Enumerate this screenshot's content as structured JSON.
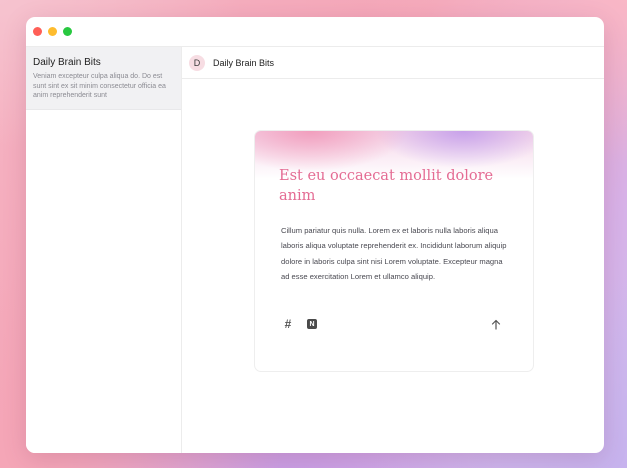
{
  "sidebar": {
    "items": [
      {
        "title": "Daily Brain Bits",
        "snippet": "Veniam excepteur culpa aliqua do. Do est sunt sint ex sit minim consectetur officia ea anim reprehenderit sunt"
      }
    ]
  },
  "main": {
    "header": {
      "avatar_letter": "D",
      "title": "Daily Brain Bits"
    },
    "card": {
      "title": "Est eu occaecat mollit dolore anim",
      "body": "Cillum pariatur quis nulla. Lorem ex et laboris nulla laboris aliqua laboris aliqua voluptate reprehenderit ex. Incididunt laborum aliquip dolore in laboris culpa sint nisi Lorem voluptate. Excepteur magna ad esse exercitation Lorem et ullamco aliquip.",
      "footer": {
        "hash_glyph": "#",
        "notion_glyph": "N"
      }
    }
  },
  "colors": {
    "title_accent": "#e46b93",
    "traffic_red": "#ff5f57",
    "traffic_yellow": "#febc2e",
    "traffic_green": "#28c840"
  },
  "icons": [
    "hash-icon",
    "notion-icon",
    "share-icon"
  ]
}
